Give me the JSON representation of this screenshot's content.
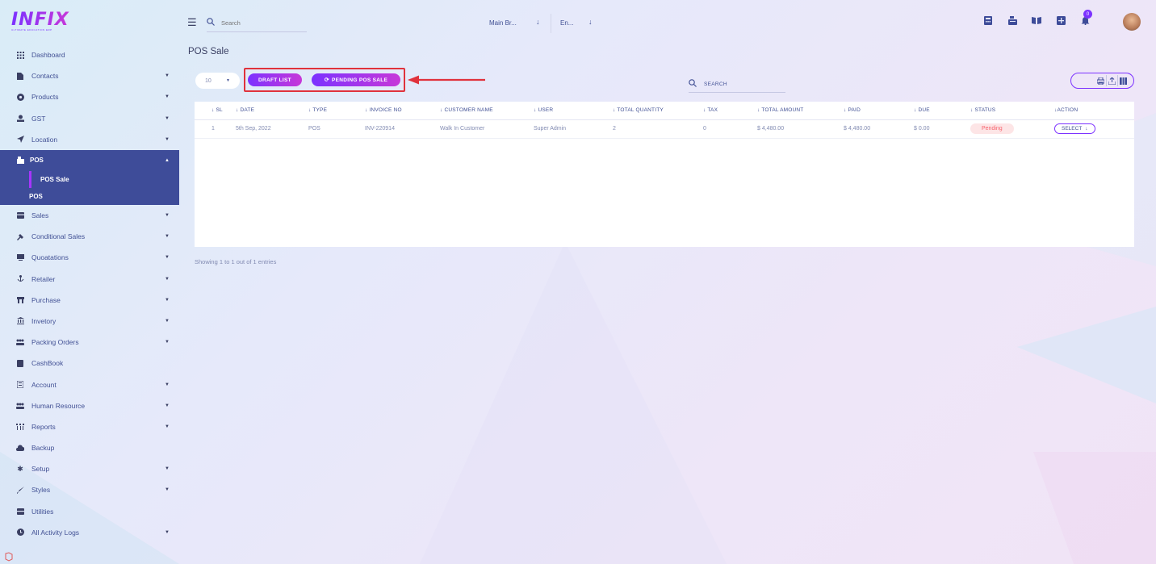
{
  "logo": {
    "text": "INFIX",
    "subtitle": "ULTIMATE EDUCATION ERP"
  },
  "header": {
    "search_placeholder": "Search",
    "branch": "Main Br...",
    "language": "En...",
    "notification_count": "0"
  },
  "sidebar": {
    "items": [
      {
        "label": "Dashboard",
        "icon": "grid-icon",
        "has_caret": false
      },
      {
        "label": "Contacts",
        "icon": "contacts-icon",
        "has_caret": true
      },
      {
        "label": "Products",
        "icon": "products-icon",
        "has_caret": true
      },
      {
        "label": "GST",
        "icon": "gst-icon",
        "has_caret": true
      },
      {
        "label": "Location",
        "icon": "location-icon",
        "has_caret": true
      }
    ],
    "active": {
      "label": "POS",
      "icon": "pos-icon"
    },
    "sub_items": [
      {
        "label": "POS Sale"
      },
      {
        "label": "POS"
      }
    ],
    "items_after": [
      {
        "label": "Sales",
        "icon": "sales-icon",
        "has_caret": true
      },
      {
        "label": "Conditional Sales",
        "icon": "gavel-icon",
        "has_caret": true
      },
      {
        "label": "Quoatations",
        "icon": "quotation-icon",
        "has_caret": true
      },
      {
        "label": "Retailer",
        "icon": "retailer-icon",
        "has_caret": true
      },
      {
        "label": "Purchase",
        "icon": "purchase-icon",
        "has_caret": true
      },
      {
        "label": "Invetory",
        "icon": "inventory-icon",
        "has_caret": true
      },
      {
        "label": "Packing Orders",
        "icon": "packing-icon",
        "has_caret": true
      },
      {
        "label": "CashBook",
        "icon": "cashbook-icon",
        "has_caret": false
      },
      {
        "label": "Account",
        "icon": "account-icon",
        "has_caret": true
      },
      {
        "label": "Human Resource",
        "icon": "users-icon",
        "has_caret": true
      },
      {
        "label": "Reports",
        "icon": "reports-icon",
        "has_caret": true
      },
      {
        "label": "Backup",
        "icon": "cloud-icon",
        "has_caret": false
      },
      {
        "label": "Setup",
        "icon": "gear-icon",
        "has_caret": true
      },
      {
        "label": "Styles",
        "icon": "brush-icon",
        "has_caret": true
      },
      {
        "label": "Utilities",
        "icon": "utilities-icon",
        "has_caret": false
      },
      {
        "label": "All Activity Logs",
        "icon": "clock-icon",
        "has_caret": true
      }
    ]
  },
  "main": {
    "title": "POS Sale",
    "page_size": "10",
    "draft_list_label": "DRAFT LIST",
    "pending_label": "PENDING POS SALE",
    "table_search_label": "SEARCH",
    "columns": [
      "SL",
      "DATE",
      "TYPE",
      "INVOICE NO",
      "CUSTOMER NAME",
      "USER",
      "TOTAL QUANTITY",
      "TAX",
      "TOTAL AMOUNT",
      "PAID",
      "DUE",
      "STATUS",
      "ACTION"
    ],
    "rows": [
      {
        "sl": "1",
        "date": "5th Sep, 2022",
        "type": "POS",
        "invoice": "INV-220914",
        "customer": "Walk In Customer",
        "user": "Super Admin",
        "quantity": "2",
        "tax": "0",
        "total": "$ 4,480.00",
        "paid": "$ 4,480.00",
        "due": "$ 0.00",
        "status": "Pending",
        "action": "SELECT"
      }
    ],
    "showing": "Showing 1 to 1 out of 1 entries"
  },
  "colors": {
    "accent_start": "#7c32ff",
    "accent_end": "#c738d8",
    "sidebar_active": "#3e4c99",
    "annotation": "#e0323c",
    "status_pending": "#f7636d"
  }
}
